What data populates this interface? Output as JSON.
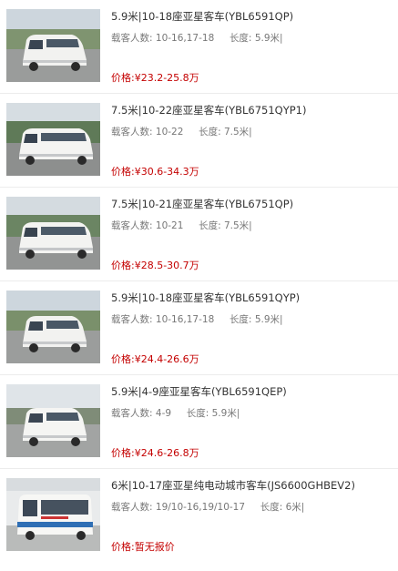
{
  "vehicles": [
    {
      "title": "5.9米|10-18座亚星客车(YBL6591QP)",
      "seats_label": "载客人数:",
      "seats": "10-16,17-18",
      "length_label": "长度:",
      "length": "5.9米|",
      "price_label": "价格:",
      "price": "¥23.2-25.8万"
    },
    {
      "title": "7.5米|10-22座亚星客车(YBL6751QYP1)",
      "seats_label": "载客人数:",
      "seats": "10-22",
      "length_label": "长度:",
      "length": "7.5米|",
      "price_label": "价格:",
      "price": "¥30.6-34.3万"
    },
    {
      "title": "7.5米|10-21座亚星客车(YBL6751QP)",
      "seats_label": "载客人数:",
      "seats": "10-21",
      "length_label": "长度:",
      "length": "7.5米|",
      "price_label": "价格:",
      "price": "¥28.5-30.7万"
    },
    {
      "title": "5.9米|10-18座亚星客车(YBL6591QYP)",
      "seats_label": "载客人数:",
      "seats": "10-16,17-18",
      "length_label": "长度:",
      "length": "5.9米|",
      "price_label": "价格:",
      "price": "¥24.4-26.6万"
    },
    {
      "title": "5.9米|4-9座亚星客车(YBL6591QEP)",
      "seats_label": "载客人数:",
      "seats": "4-9",
      "length_label": "长度:",
      "length": "5.9米|",
      "price_label": "价格:",
      "price": "¥24.6-26.8万"
    },
    {
      "title": "6米|10-17座亚星纯电动城市客车(JS6600GHBEV2)",
      "seats_label": "载客人数:",
      "seats": "19/10-16,19/10-17",
      "length_label": "长度:",
      "length": "6米|",
      "price_label": "价格:",
      "price": "暂无报价"
    }
  ]
}
